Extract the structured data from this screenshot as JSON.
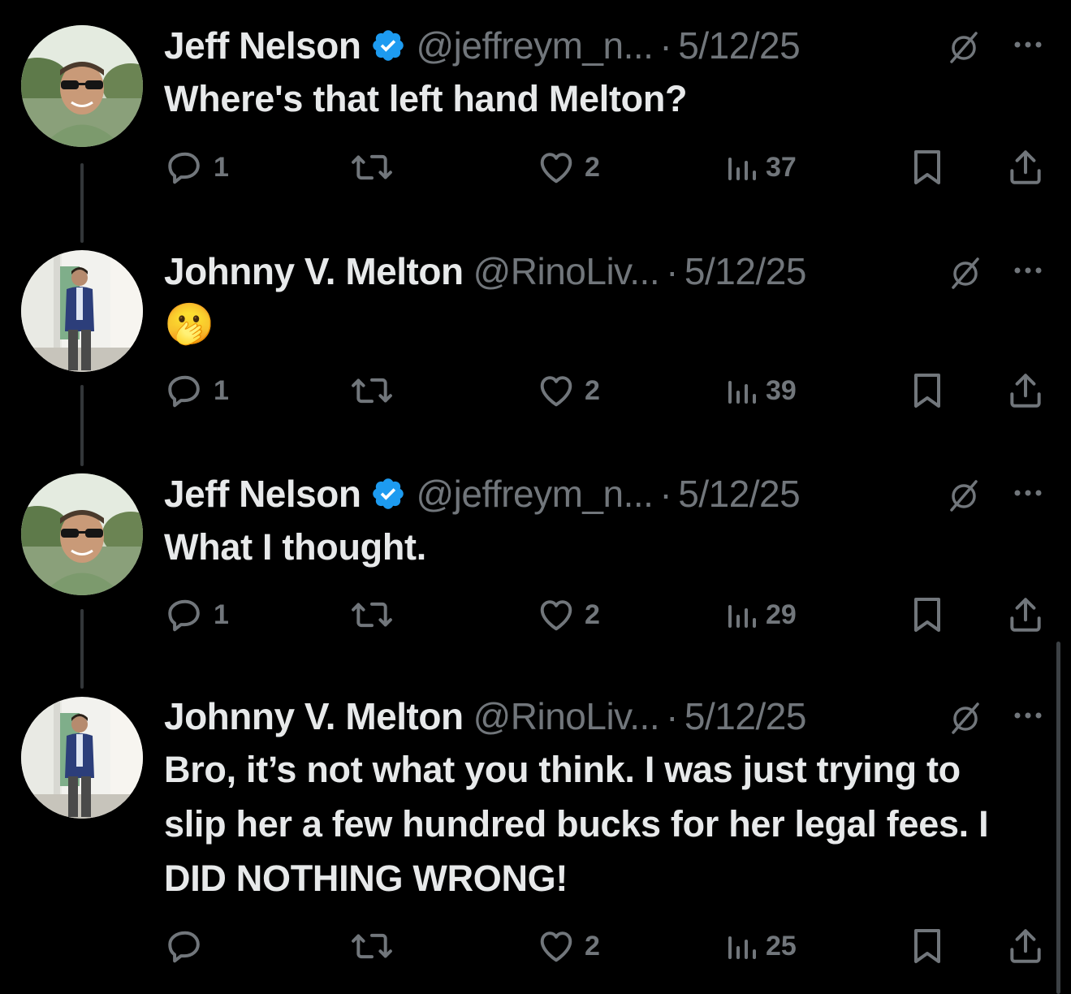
{
  "colors": {
    "background": "#000000",
    "primary_text": "#e7e9ea",
    "secondary_text": "#71767b",
    "verified_blue": "#1d9bf0",
    "thread_line": "#333639"
  },
  "separator": "·",
  "icons": {
    "reply": "reply-icon",
    "retweet": "retweet-icon",
    "like": "like-icon",
    "views": "views-icon",
    "bookmark": "bookmark-icon",
    "share": "share-icon",
    "grok": "grok-icon",
    "more": "more-icon",
    "verified": "verified-badge-icon"
  },
  "tweets": [
    {
      "name": "Jeff Nelson",
      "verified": true,
      "handle": "@jeffreym_n...",
      "date": "5/12/25",
      "text": "Where's that left hand Melton?",
      "replies": "1",
      "likes": "2",
      "views": "37"
    },
    {
      "name": "Johnny V. Melton",
      "verified": false,
      "handle": "@RinoLiv...",
      "date": "5/12/25",
      "text": "🫢",
      "replies": "1",
      "likes": "2",
      "views": "39"
    },
    {
      "name": "Jeff Nelson",
      "verified": true,
      "handle": "@jeffreym_n...",
      "date": "5/12/25",
      "text": "What I thought.",
      "replies": "1",
      "likes": "2",
      "views": "29"
    },
    {
      "name": "Johnny V. Melton",
      "verified": false,
      "handle": "@RinoLiv...",
      "date": "5/12/25",
      "text": "Bro, it’s not what you think. I was just trying to slip her a few hundred bucks for her legal fees. I DID NOTHING WRONG!",
      "replies": "",
      "likes": "2",
      "views": "25"
    }
  ]
}
